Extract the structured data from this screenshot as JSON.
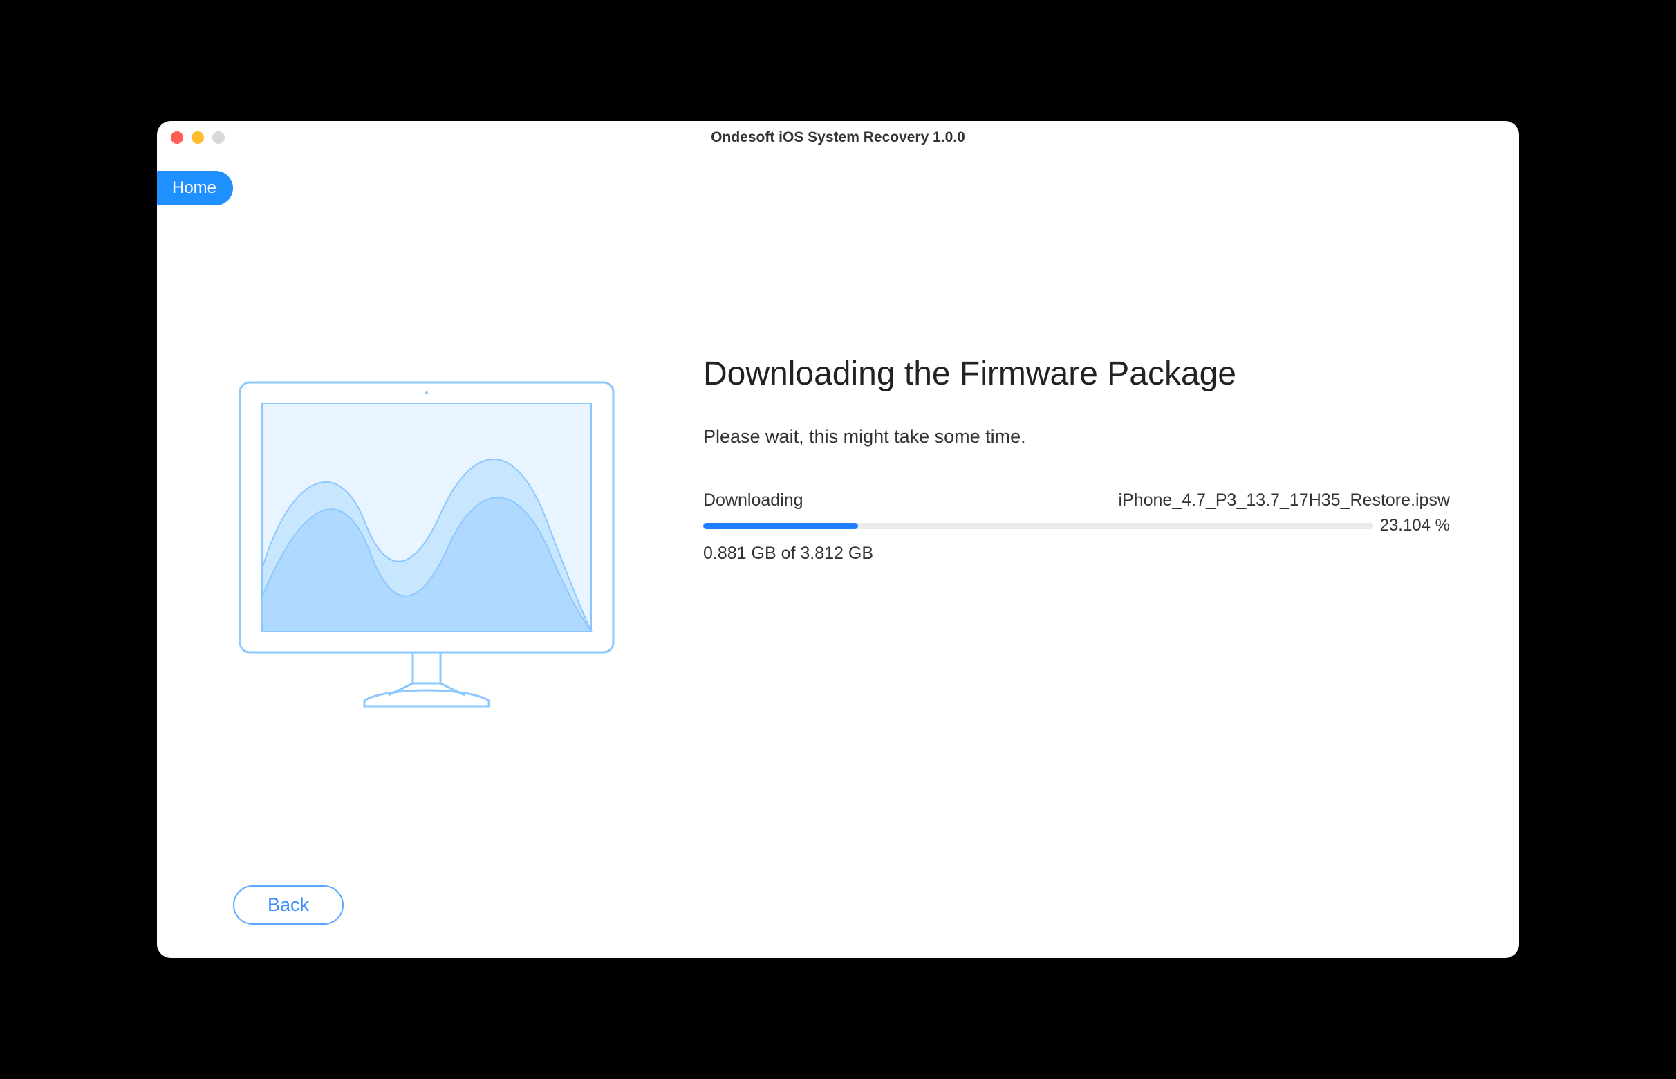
{
  "window": {
    "title": "Ondesoft iOS System Recovery 1.0.0"
  },
  "nav": {
    "home_label": "Home"
  },
  "main": {
    "heading": "Downloading the Firmware Package",
    "subtext": "Please wait, this might take some time.",
    "status_label": "Downloading",
    "filename": "iPhone_4.7_P3_13.7_17H35_Restore.ipsw",
    "percent_text": "23.104 %",
    "progress_percent": 23.104,
    "size_text": "0.881 GB of 3.812 GB"
  },
  "footer": {
    "back_label": "Back"
  },
  "colors": {
    "accent": "#1e90ff",
    "progress": "#1e7eff"
  }
}
